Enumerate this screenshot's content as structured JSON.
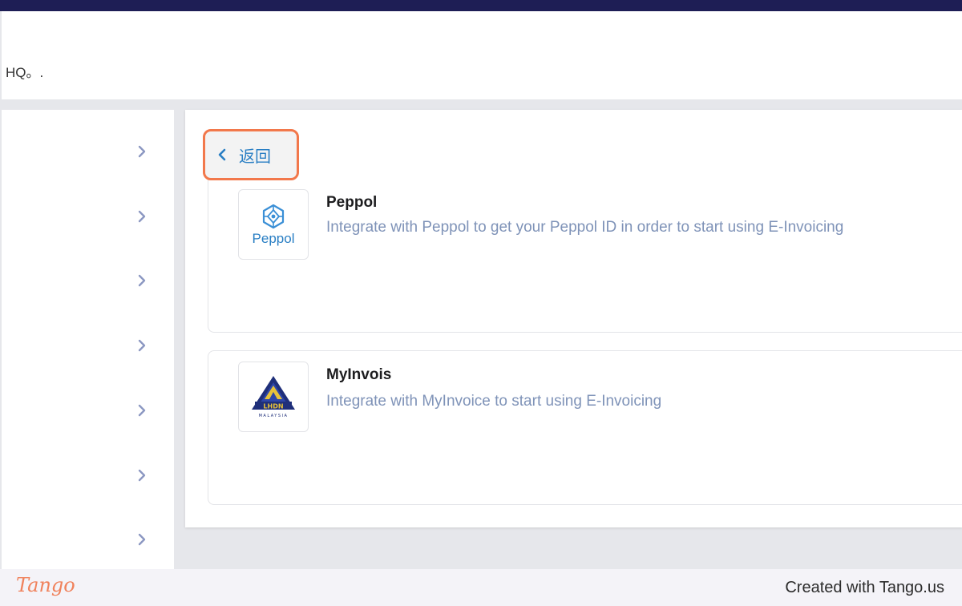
{
  "header": {
    "text": "HQ。."
  },
  "sidebar": {
    "chevrons": 7
  },
  "back_button": {
    "label": "返回"
  },
  "integrations": [
    {
      "title": "Peppol",
      "description": "Integrate with Peppol to get your Peppol ID in order to start using E-Invoicing",
      "logo_text": "Peppol"
    },
    {
      "title": "MyInvois",
      "description": "Integrate with MyInvoice to start using E-Invoicing",
      "logo_text": "LHDN",
      "logo_subtext": "MALAYSIA"
    }
  ],
  "footer": {
    "brand": "Tango",
    "created_text": "Created with Tango.us"
  },
  "colors": {
    "accent": "#2a7fc4",
    "highlight": "#f2784b",
    "topbar": "#1e1e55",
    "chevron": "#8c98c2"
  }
}
